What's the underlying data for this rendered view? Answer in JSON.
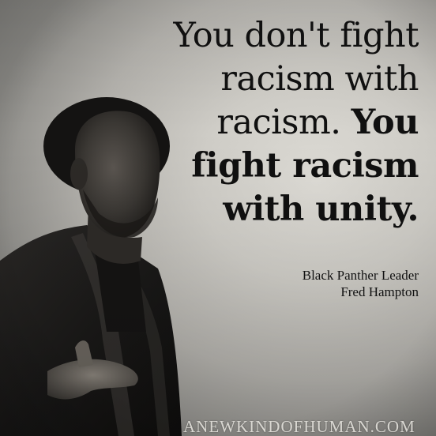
{
  "quote": {
    "line1": "You don't fight",
    "line2": "racism with",
    "line3_regular": "racism.",
    "line3_bold": "You",
    "line4": "fight racism",
    "line5": "with unity."
  },
  "attribution": {
    "title": "Black Panther Leader",
    "name": "Fred Hampton"
  },
  "watermark": "ANEWKINDOFHUMAN.COM",
  "colors": {
    "text": "#101010",
    "background_light": "#dedcd6",
    "background_dark": "#8a8985",
    "watermark": "#e8e6e0"
  }
}
